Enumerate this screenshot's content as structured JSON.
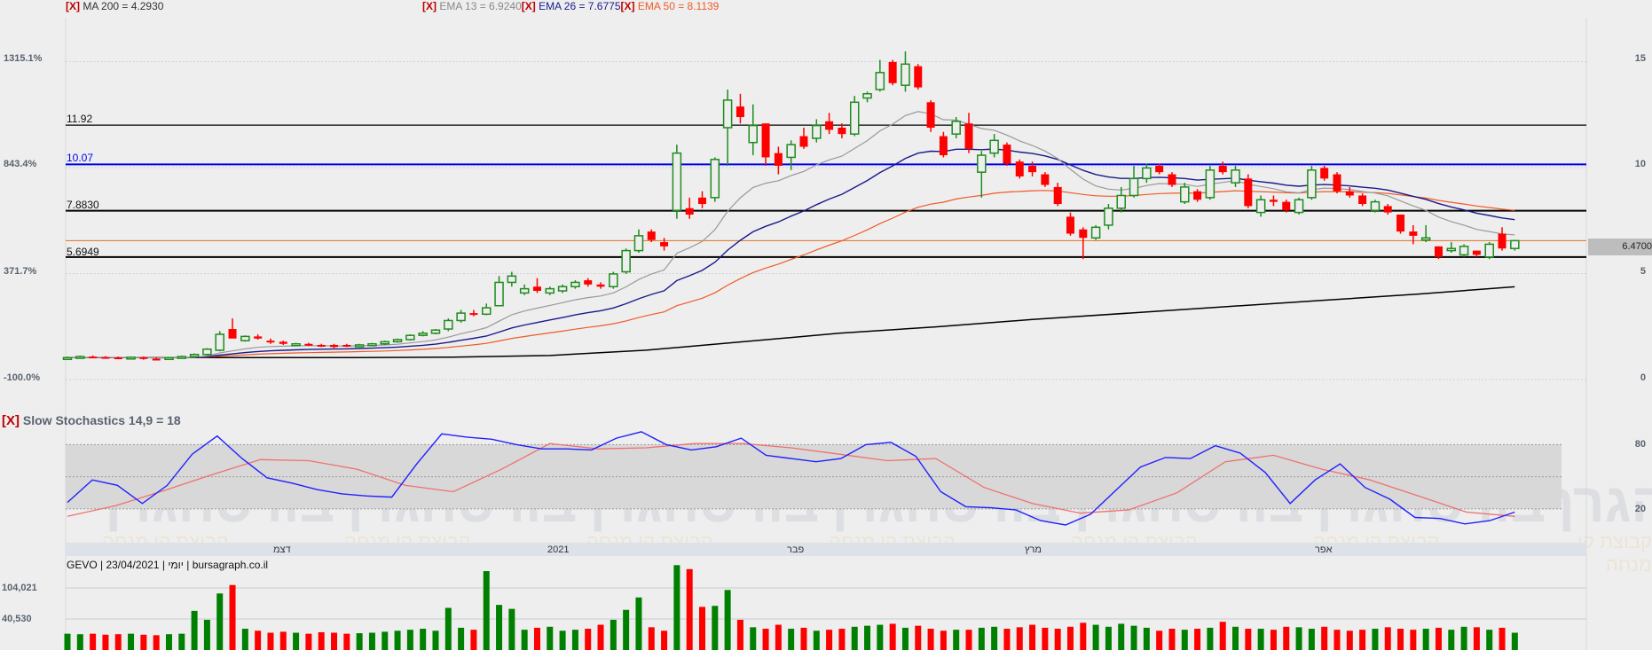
{
  "legend": {
    "close_marker": "[X]",
    "ma200": {
      "label": "MA 200 = 4.2930",
      "color": "#000000"
    },
    "ema13": {
      "label": "EMA 13 = 6.9240",
      "color": "#999999"
    },
    "ema26": {
      "label": "EMA 26 = 7.6775",
      "color": "#1a1a8c"
    },
    "ema50": {
      "label": "EMA 50 = 8.1139",
      "color": "#f05a28"
    }
  },
  "price_axis": {
    "right_ticks": [
      "15",
      "10",
      "5",
      "0"
    ],
    "left_percent_ticks": [
      "1315.1%",
      "843.4%",
      "371.7%",
      "-100.0%"
    ],
    "last_price_tag": "6.4700"
  },
  "levels": [
    {
      "label": "11.92",
      "value": 11.92,
      "color": "#000000"
    },
    {
      "label": "10.07",
      "value": 10.07,
      "color": "#0000ee"
    },
    {
      "label": "7.8830",
      "value": 7.883,
      "color": "#000000"
    },
    {
      "label": "5.6949",
      "value": 5.6949,
      "color": "#000000"
    }
  ],
  "last_price_line": {
    "value": 6.47,
    "color": "#e07020"
  },
  "stochastics": {
    "title": "Slow Stochastics 14,9 = 18",
    "ticks": [
      "80",
      "20"
    ],
    "k_color": "#2020ff",
    "d_color": "#f07070"
  },
  "x_axis": {
    "months": [
      "דצמ",
      "2021",
      "פבר",
      "מרץ",
      "אפר"
    ]
  },
  "volume": {
    "title": "GEVO | 23/04/2021 | יומי | bursagraph.co.il",
    "ticks": [
      "104,021",
      "40,530"
    ],
    "up_color": "#008000",
    "down_color": "#ff0000"
  },
  "watermark": {
    "main": "בורסהגרף",
    "sub": "קבוצת קו מנחה"
  },
  "chart_data": {
    "type": "candlestick",
    "ticker": "GEVO",
    "date": "23/04/2021",
    "ylim": [
      0,
      15
    ],
    "grid": true,
    "ohlc": [
      [
        0.95,
        1.0,
        0.9,
        0.95
      ],
      [
        0.95,
        1.05,
        0.92,
        1.0
      ],
      [
        1.0,
        1.05,
        0.95,
        0.98
      ],
      [
        0.98,
        1.02,
        0.93,
        0.96
      ],
      [
        0.96,
        1.0,
        0.9,
        0.93
      ],
      [
        0.93,
        1.0,
        0.88,
        0.97
      ],
      [
        0.97,
        1.0,
        0.85,
        0.9
      ],
      [
        0.9,
        0.95,
        0.82,
        0.88
      ],
      [
        0.88,
        0.98,
        0.85,
        0.95
      ],
      [
        0.95,
        1.05,
        0.92,
        1.0
      ],
      [
        1.0,
        1.15,
        0.98,
        1.1
      ],
      [
        1.1,
        1.4,
        1.05,
        1.35
      ],
      [
        1.3,
        2.2,
        1.25,
        2.05
      ],
      [
        2.3,
        2.8,
        1.9,
        1.85
      ],
      [
        1.75,
        2.0,
        1.7,
        1.95
      ],
      [
        1.95,
        2.05,
        1.8,
        1.85
      ],
      [
        1.75,
        1.85,
        1.6,
        1.7
      ],
      [
        1.7,
        1.75,
        1.55,
        1.6
      ],
      [
        1.55,
        1.65,
        1.5,
        1.6
      ],
      [
        1.6,
        1.65,
        1.5,
        1.55
      ],
      [
        1.55,
        1.6,
        1.45,
        1.5
      ],
      [
        1.55,
        1.6,
        1.4,
        1.45
      ],
      [
        1.55,
        1.6,
        1.45,
        1.5
      ],
      [
        1.5,
        1.6,
        1.45,
        1.55
      ],
      [
        1.55,
        1.65,
        1.5,
        1.6
      ],
      [
        1.6,
        1.75,
        1.55,
        1.7
      ],
      [
        1.7,
        1.85,
        1.65,
        1.8
      ],
      [
        1.8,
        2.05,
        1.75,
        2.0
      ],
      [
        2.0,
        2.2,
        1.95,
        2.1
      ],
      [
        2.1,
        2.3,
        2.05,
        2.25
      ],
      [
        2.3,
        2.8,
        2.2,
        2.7
      ],
      [
        2.7,
        3.2,
        2.6,
        3.05
      ],
      [
        3.05,
        3.2,
        2.9,
        3.0
      ],
      [
        3.0,
        3.5,
        2.95,
        3.3
      ],
      [
        3.4,
        4.8,
        3.4,
        4.5
      ],
      [
        4.5,
        5.0,
        4.3,
        4.8
      ],
      [
        4.0,
        4.4,
        3.9,
        4.2
      ],
      [
        4.3,
        4.7,
        4.0,
        4.1
      ],
      [
        4.0,
        4.3,
        3.9,
        4.2
      ],
      [
        4.1,
        4.4,
        4.0,
        4.3
      ],
      [
        4.3,
        4.6,
        4.2,
        4.5
      ],
      [
        4.6,
        4.7,
        4.3,
        4.4
      ],
      [
        4.4,
        4.5,
        4.2,
        4.3
      ],
      [
        4.3,
        5.0,
        4.2,
        4.9
      ],
      [
        5.0,
        6.1,
        4.9,
        6.0
      ],
      [
        6.0,
        7.0,
        5.9,
        6.7
      ],
      [
        6.9,
        7.0,
        6.4,
        6.5
      ],
      [
        6.4,
        6.6,
        6.0,
        6.2
      ],
      [
        7.9,
        11.0,
        7.5,
        10.6
      ],
      [
        8.0,
        8.5,
        7.5,
        7.7
      ],
      [
        8.5,
        8.8,
        8.0,
        8.2
      ],
      [
        8.5,
        10.4,
        8.3,
        10.3
      ],
      [
        11.8,
        13.6,
        10.0,
        13.1
      ],
      [
        12.8,
        13.4,
        12.0,
        12.3
      ],
      [
        11.1,
        12.9,
        10.5,
        11.9
      ],
      [
        12.0,
        12.0,
        10.0,
        10.4
      ],
      [
        10.6,
        10.9,
        9.6,
        10.0
      ],
      [
        10.4,
        11.2,
        9.8,
        11.0
      ],
      [
        11.4,
        11.8,
        10.8,
        10.9
      ],
      [
        11.3,
        12.2,
        11.1,
        11.9
      ],
      [
        12.1,
        12.5,
        11.5,
        11.7
      ],
      [
        11.8,
        12.0,
        11.3,
        11.5
      ],
      [
        11.5,
        13.3,
        11.4,
        13.0
      ],
      [
        13.2,
        13.5,
        13.0,
        13.4
      ],
      [
        13.6,
        15.0,
        13.5,
        14.4
      ],
      [
        14.9,
        15.0,
        13.8,
        13.9
      ],
      [
        13.8,
        15.4,
        13.5,
        14.8
      ],
      [
        14.7,
        14.8,
        13.6,
        13.7
      ],
      [
        13.0,
        13.1,
        11.6,
        11.8
      ],
      [
        11.4,
        11.6,
        10.4,
        10.5
      ],
      [
        11.5,
        12.3,
        11.3,
        12.1
      ],
      [
        12.0,
        12.5,
        10.6,
        10.8
      ],
      [
        9.7,
        10.7,
        8.5,
        10.5
      ],
      [
        10.6,
        11.5,
        10.4,
        11.2
      ],
      [
        11.0,
        11.1,
        10.0,
        10.1
      ],
      [
        10.2,
        10.3,
        9.4,
        9.5
      ],
      [
        10.0,
        10.2,
        9.5,
        9.7
      ],
      [
        9.6,
        9.7,
        9.0,
        9.1
      ],
      [
        9.0,
        9.2,
        8.1,
        8.2
      ],
      [
        7.6,
        7.8,
        6.7,
        6.8
      ],
      [
        7.0,
        7.1,
        5.6,
        6.6
      ],
      [
        6.6,
        7.2,
        6.5,
        7.1
      ],
      [
        7.2,
        8.2,
        7.0,
        8.0
      ],
      [
        8.0,
        9.0,
        7.8,
        8.6
      ],
      [
        8.6,
        10.0,
        8.5,
        9.4
      ],
      [
        9.4,
        10.1,
        9.2,
        9.9
      ],
      [
        10.0,
        10.1,
        9.6,
        9.7
      ],
      [
        9.6,
        9.7,
        9.0,
        9.1
      ],
      [
        8.3,
        9.2,
        8.2,
        9.0
      ],
      [
        8.8,
        8.9,
        8.3,
        8.4
      ],
      [
        8.5,
        10.0,
        8.4,
        9.8
      ],
      [
        10.0,
        10.2,
        9.6,
        9.7
      ],
      [
        9.2,
        10.0,
        9.0,
        9.8
      ],
      [
        9.4,
        9.6,
        8.0,
        8.1
      ],
      [
        7.8,
        8.6,
        7.6,
        8.4
      ],
      [
        8.4,
        8.6,
        8.1,
        8.3
      ],
      [
        8.3,
        8.4,
        7.8,
        7.9
      ],
      [
        7.8,
        8.5,
        7.7,
        8.4
      ],
      [
        8.5,
        10.0,
        8.4,
        9.8
      ],
      [
        9.9,
        10.0,
        9.3,
        9.4
      ],
      [
        9.6,
        9.7,
        8.7,
        8.8
      ],
      [
        8.8,
        9.0,
        8.5,
        8.6
      ],
      [
        8.6,
        8.7,
        8.1,
        8.2
      ],
      [
        7.9,
        8.4,
        7.8,
        8.3
      ],
      [
        8.1,
        8.2,
        7.7,
        7.8
      ],
      [
        7.7,
        7.7,
        6.8,
        6.9
      ],
      [
        6.9,
        7.2,
        6.3,
        6.7
      ],
      [
        6.5,
        7.2,
        6.4,
        6.6
      ],
      [
        6.2,
        6.2,
        5.6,
        5.7
      ],
      [
        6.0,
        6.4,
        5.9,
        6.1
      ],
      [
        5.8,
        6.3,
        5.7,
        6.2
      ],
      [
        6.0,
        6.0,
        5.7,
        5.8
      ],
      [
        5.7,
        6.4,
        5.6,
        6.3
      ],
      [
        6.8,
        7.1,
        6.0,
        6.1
      ],
      [
        6.1,
        6.5,
        6.0,
        6.47
      ]
    ],
    "ma200": [
      0.95,
      0.95,
      0.95,
      0.95,
      0.97,
      1.05,
      1.3,
      1.7,
      2.1,
      2.4,
      2.75,
      3.05,
      3.35,
      3.65,
      3.95,
      4.293
    ],
    "volume": [
      12000,
      11000,
      12000,
      10000,
      11000,
      12000,
      10000,
      9000,
      11000,
      12000,
      58000,
      40000,
      93000,
      110000,
      22000,
      18000,
      14000,
      16000,
      14000,
      12000,
      15000,
      14000,
      12000,
      13000,
      14000,
      16000,
      18000,
      20000,
      22000,
      18000,
      64000,
      24000,
      20000,
      138000,
      70000,
      62000,
      20000,
      24000,
      26000,
      18000,
      20000,
      22000,
      30000,
      40000,
      60000,
      85000,
      25000,
      18000,
      150000,
      142000,
      66000,
      68000,
      100000,
      40000,
      25000,
      22000,
      30000,
      22000,
      24000,
      18000,
      20000,
      22000,
      26000,
      28000,
      30000,
      32000,
      24000,
      28000,
      22000,
      18000,
      20000,
      20000,
      24000,
      26000,
      22000,
      25000,
      30000,
      24000,
      22000,
      26000,
      34000,
      30000,
      26000,
      32000,
      28000,
      24000,
      18000,
      22000,
      20000,
      22000,
      24000,
      36000,
      26000,
      22000,
      22000,
      20000,
      26000,
      25000,
      22000,
      26000,
      20000,
      18000,
      20000,
      22000,
      25000,
      22000,
      20000,
      22000,
      24000,
      20000,
      26000,
      25000,
      20000,
      24000,
      14000
    ],
    "stoch_k": [
      26,
      47,
      42,
      25,
      42,
      71,
      88,
      67,
      49,
      44,
      38,
      34,
      32,
      31,
      62,
      90,
      87,
      85,
      80,
      76,
      76,
      75,
      86,
      92,
      80,
      75,
      78,
      86,
      70,
      67,
      64,
      67,
      80,
      82,
      69,
      36,
      22,
      21,
      19,
      9,
      5,
      15,
      37,
      59,
      68,
      67,
      79,
      72,
      54,
      25,
      47,
      62,
      40,
      29,
      12,
      11,
      6,
      9,
      17
    ],
    "stoch_d": [
      13,
      23,
      37,
      52,
      66,
      65,
      57,
      42,
      36,
      57,
      81,
      76,
      77,
      81,
      81,
      77,
      71,
      65,
      67,
      40,
      25,
      16,
      19,
      35,
      64,
      70,
      57,
      47,
      32,
      17,
      13
    ],
    "stoch_ylim": [
      0,
      100
    ],
    "stoch_bands": [
      20,
      50,
      80
    ]
  }
}
